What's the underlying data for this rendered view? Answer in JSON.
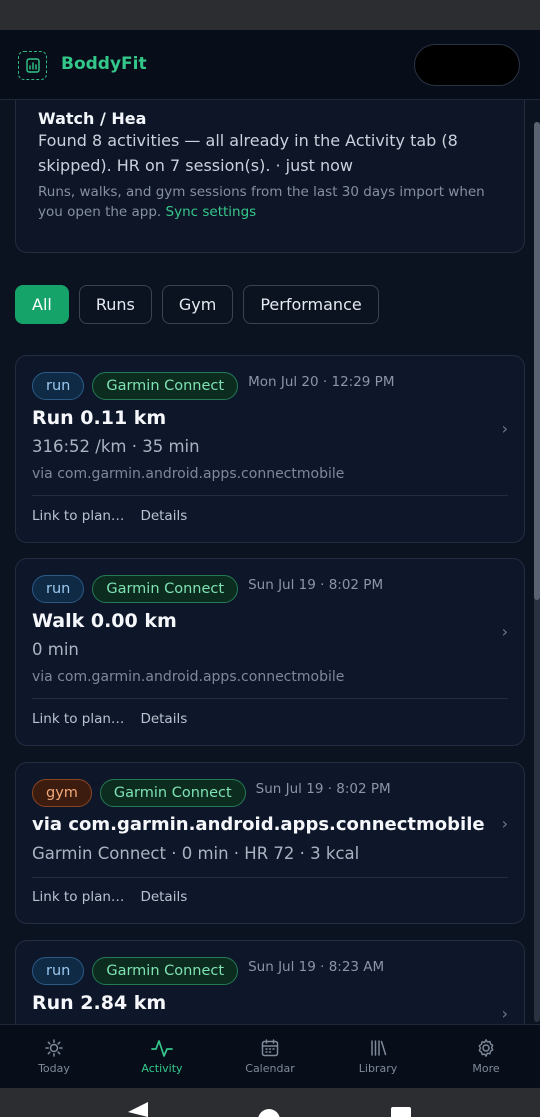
{
  "app": {
    "name": "BoddyFit"
  },
  "sync": {
    "title": "Watch / Heal",
    "message": "Found 8 activities — all already in the Activity tab (8 skipped). HR on 7 session(s). · just now",
    "note": "Runs, walks, and gym sessions from the last 30 days import when you open the app.",
    "link": "Sync settings"
  },
  "filters": [
    {
      "label": "All",
      "active": true
    },
    {
      "label": "Runs",
      "active": false
    },
    {
      "label": "Gym",
      "active": false
    },
    {
      "label": "Performance",
      "active": false
    }
  ],
  "activities": [
    {
      "type": "run",
      "source": "Garmin Connect",
      "when": "Mon Jul 20 · 12:29 PM",
      "title": "Run 0.11 km",
      "meta": "316:52 /km · 35 min",
      "via": "via com.garmin.android.apps.connectmobile",
      "link_label": "Link to plan…",
      "details_label": "Details"
    },
    {
      "type": "run",
      "source": "Garmin Connect",
      "when": "Sun Jul 19 · 8:02 PM",
      "title": "Walk 0.00 km",
      "meta": "0 min",
      "via": "via com.garmin.android.apps.connectmobile",
      "link_label": "Link to plan…",
      "details_label": "Details"
    },
    {
      "type": "gym",
      "source": "Garmin Connect",
      "when": "Sun Jul 19 · 8:02 PM",
      "title": "via com.garmin.android.apps.connectmobile",
      "meta": "Garmin Connect · 0 min · HR 72 · 3 kcal",
      "link_label": "Link to plan…",
      "details_label": "Details"
    },
    {
      "type": "run",
      "source": "Garmin Connect",
      "when": "Sun Jul 19 · 8:23 AM",
      "title": "Run 2.84 km"
    }
  ],
  "tabs": [
    {
      "label": "Today",
      "icon": "sun-icon",
      "active": false
    },
    {
      "label": "Activity",
      "icon": "activity-pulse-icon",
      "active": true
    },
    {
      "label": "Calendar",
      "icon": "calendar-icon",
      "active": false
    },
    {
      "label": "Library",
      "icon": "library-icon",
      "active": false
    },
    {
      "label": "More",
      "icon": "gear-icon",
      "active": false
    }
  ],
  "colors": {
    "accent": "#16a36a",
    "background": "#0b1220",
    "card": "#0e172a"
  }
}
